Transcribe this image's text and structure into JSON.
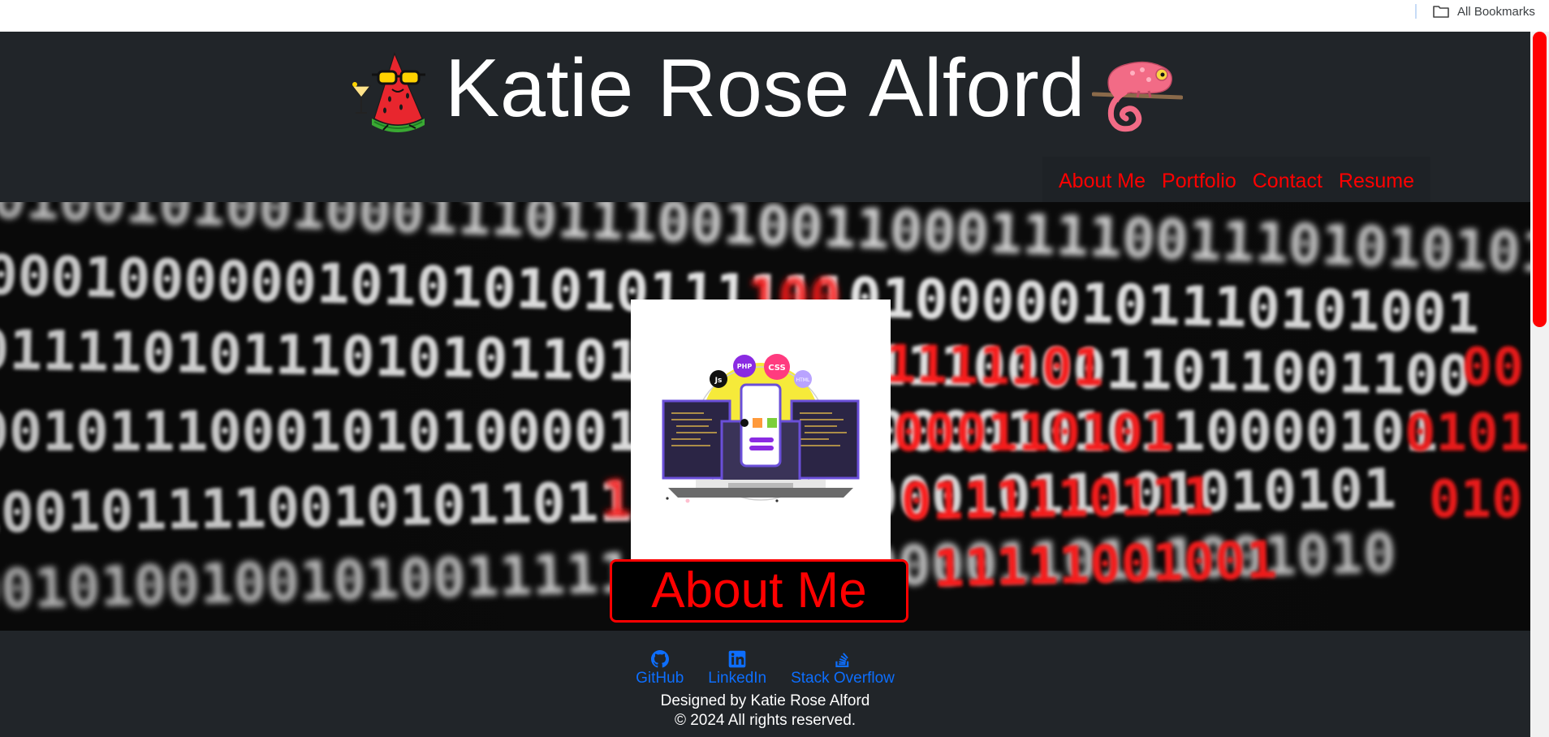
{
  "browser": {
    "bookmarks_label": "All Bookmarks"
  },
  "header": {
    "title": "Katie Rose Alford",
    "left_icon": "watermelon-with-sunglasses-icon",
    "right_icon": "chameleon-icon",
    "nav": [
      "About Me",
      "Portfolio",
      "Contact",
      "Resume"
    ]
  },
  "hero": {
    "background": "binary-code-red-white",
    "card_image": "developer-workstation-illustration",
    "card_badges": [
      "Js",
      "PHP",
      "CSS",
      "HTML"
    ],
    "section_title": "About Me"
  },
  "footer": {
    "links": [
      {
        "label": "GitHub",
        "icon": "github-icon"
      },
      {
        "label": "LinkedIn",
        "icon": "linkedin-icon"
      },
      {
        "label": "Stack Overflow",
        "icon": "stack-overflow-icon"
      }
    ],
    "designed_by": "Designed by Katie Rose Alford",
    "copyright": "© 2024 All rights reserved."
  },
  "colors": {
    "accent": "#ff0000",
    "link": "#0d6efd",
    "background": "#212529"
  }
}
